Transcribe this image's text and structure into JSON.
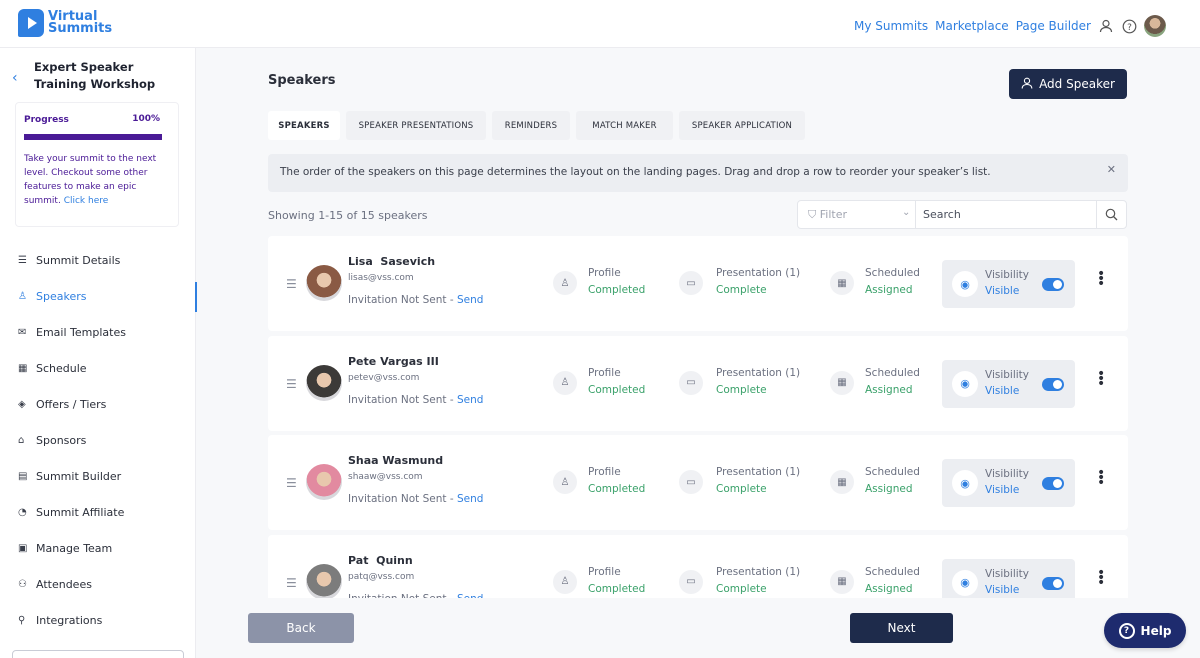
{
  "app": {
    "logo_line1": "Virtual",
    "logo_line2": "Summits"
  },
  "topnav": {
    "my_summits": "My Summits",
    "marketplace": "Marketplace",
    "page_builder": "Page Builder"
  },
  "sidebar": {
    "back_title": "Expert Speaker Training Workshop",
    "progress": {
      "label": "Progress",
      "percent_text": "100%",
      "value": 1.0,
      "text": "Take your summit to the next level. Checkout some other features to make an epic summit.",
      "link": "Click here"
    },
    "items": [
      {
        "label": "Summit Details",
        "icon": "list-icon",
        "glyph": "☰"
      },
      {
        "label": "Speakers",
        "icon": "person-icon",
        "glyph": "♙"
      },
      {
        "label": "Email Templates",
        "icon": "mail-icon",
        "glyph": "✉"
      },
      {
        "label": "Schedule",
        "icon": "calendar-icon",
        "glyph": "▦"
      },
      {
        "label": "Offers / Tiers",
        "icon": "tag-icon",
        "glyph": "◈"
      },
      {
        "label": "Sponsors",
        "icon": "building-icon",
        "glyph": "⌂"
      },
      {
        "label": "Summit Builder",
        "icon": "layout-icon",
        "glyph": "▤"
      },
      {
        "label": "Summit Affiliate",
        "icon": "gauge-icon",
        "glyph": "◔"
      },
      {
        "label": "Manage Team",
        "icon": "team-icon",
        "glyph": "▣"
      },
      {
        "label": "Attendees",
        "icon": "attendees-icon",
        "glyph": "⚇"
      },
      {
        "label": "Integrations",
        "icon": "plug-icon",
        "glyph": "⚲"
      }
    ],
    "active_index": 1
  },
  "main": {
    "title": "Speakers",
    "add_button": "Add Speaker",
    "tabs": [
      {
        "label": "SPEAKERS",
        "active": true
      },
      {
        "label": "SPEAKER PRESENTATIONS",
        "active": false
      },
      {
        "label": "REMINDERS",
        "active": false
      },
      {
        "label": "MATCH MAKER",
        "active": false
      },
      {
        "label": "SPEAKER APPLICATION",
        "active": false
      }
    ],
    "banner": "The order of the speakers on this page determines the layout on the landing pages. Drag and drop a row to reorder your speaker’s list.",
    "showing": "Showing 1-15 of 15 speakers",
    "filter_label": "Filter",
    "search_placeholder": "Search",
    "speakers": [
      {
        "name": "Lisa  Sasevich",
        "email": "lisas@vss.com",
        "invite_status": "Invitation Not Sent -",
        "send_label": "Send",
        "profile_label": "Profile",
        "profile_value": "Completed",
        "presentation_label": "Presentation (1)",
        "presentation_value": "Complete",
        "schedule_label": "Scheduled",
        "schedule_value": "Assigned",
        "visibility_label": "Visibility",
        "visibility_value": "Visible",
        "avatar_color": "#8a5a44"
      },
      {
        "name": "Pete Vargas III",
        "email": "petev@vss.com",
        "invite_status": "Invitation Not Sent -",
        "send_label": "Send",
        "profile_label": "Profile",
        "profile_value": "Completed",
        "presentation_label": "Presentation (1)",
        "presentation_value": "Complete",
        "schedule_label": "Scheduled",
        "schedule_value": "Assigned",
        "visibility_label": "Visibility",
        "visibility_value": "Visible",
        "avatar_color": "#3c3a38"
      },
      {
        "name": "Shaa Wasmund",
        "email": "shaaw@vss.com",
        "invite_status": "Invitation Not Sent -",
        "send_label": "Send",
        "profile_label": "Profile",
        "profile_value": "Completed",
        "presentation_label": "Presentation (1)",
        "presentation_value": "Complete",
        "schedule_label": "Scheduled",
        "schedule_value": "Assigned",
        "visibility_label": "Visibility",
        "visibility_value": "Visible",
        "avatar_color": "#e28aa0"
      },
      {
        "name": "Pat  Quinn",
        "email": "patq@vss.com",
        "invite_status": "Invitation Not Sent -",
        "send_label": "Send",
        "profile_label": "Profile",
        "profile_value": "Completed",
        "presentation_label": "Presentation (1)",
        "presentation_value": "Complete",
        "schedule_label": "Scheduled",
        "schedule_value": "Assigned",
        "visibility_label": "Visibility",
        "visibility_value": "Visible",
        "avatar_color": "#7c7c7c"
      }
    ]
  },
  "footer": {
    "back": "Back",
    "next": "Next",
    "help": "Help"
  },
  "colors": {
    "brand_blue": "#2f7fe0",
    "navy": "#1e2b4b",
    "purple": "#4a1a96",
    "success": "#3aa16a"
  }
}
